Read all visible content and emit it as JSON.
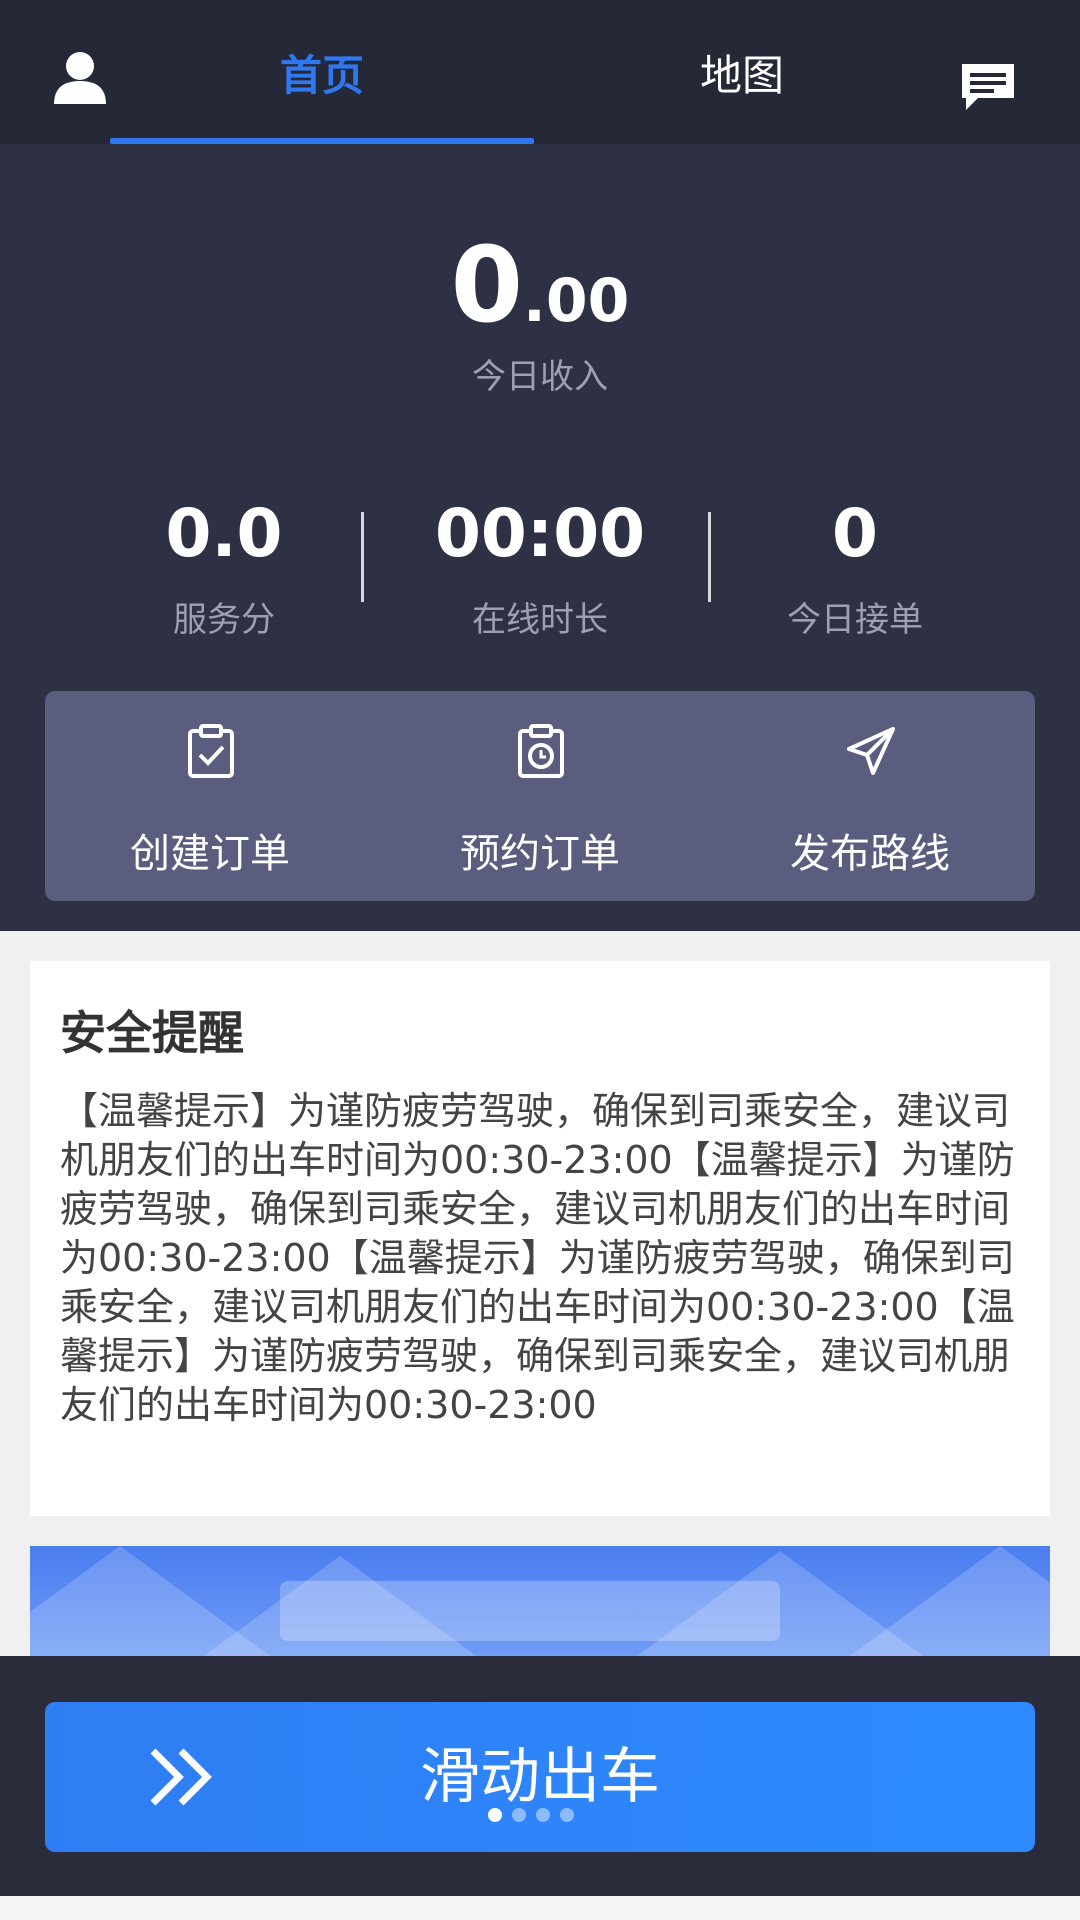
{
  "nav": {
    "tab_home": "首页",
    "tab_map": "地图",
    "active_tab": "home",
    "accent_color": "#2f78f0",
    "left_icon": "user-avatar-icon",
    "right_icon": "message-icon"
  },
  "dashboard": {
    "income_int": "0",
    "income_dec": ".00",
    "income_label": "今日收入",
    "stats": [
      {
        "value": "0.0",
        "label": "服务分"
      },
      {
        "value": "00:00",
        "label": "在线时长"
      },
      {
        "value": "0",
        "label": "今日接单"
      }
    ],
    "actions": [
      {
        "label": "创建订单",
        "icon": "clipboard-check-icon"
      },
      {
        "label": "预约订单",
        "icon": "clipboard-clock-icon"
      },
      {
        "label": "发布路线",
        "icon": "paper-plane-icon"
      }
    ]
  },
  "safety": {
    "title": "安全提醒",
    "text": "【温馨提示】为谨防疲劳驾驶，确保到司乘安全，建议司机朋友们的出车时间为00:30-23:00【温馨提示】为谨防疲劳驾驶，确保到司乘安全，建议司机朋友们的出车时间为00:30-23:00【温馨提示】为谨防疲劳驾驶，确保到司乘安全，建议司机朋友们的出车时间为00:30-23:00【温馨提示】为谨防疲劳驾驶，确保到司乘安全，建议司机朋友们的出车时间为00:30-23:00"
  },
  "bottom": {
    "slide_label": "滑动出车",
    "slide_icon": "double-chevron-right-icon",
    "page_dots": 4,
    "active_dot": 1
  }
}
